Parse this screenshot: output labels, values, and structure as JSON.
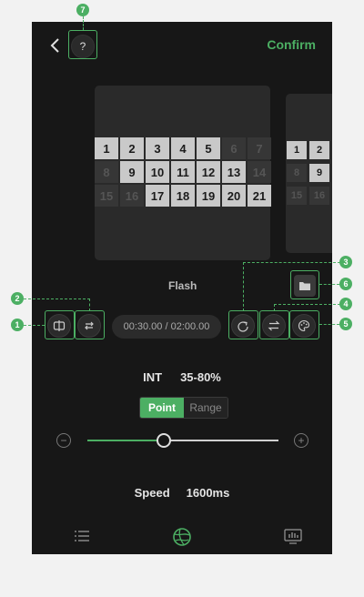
{
  "header": {
    "back_icon": "chevron-left-icon",
    "help_label": "?",
    "confirm_label": "Confirm"
  },
  "pattern": {
    "caption": "Flash",
    "cells": [
      {
        "n": "1",
        "on": true
      },
      {
        "n": "2",
        "on": true
      },
      {
        "n": "3",
        "on": true
      },
      {
        "n": "4",
        "on": true
      },
      {
        "n": "5",
        "on": true
      },
      {
        "n": "6",
        "on": false
      },
      {
        "n": "7",
        "on": false
      },
      {
        "n": "8",
        "on": false
      },
      {
        "n": "9",
        "on": true
      },
      {
        "n": "10",
        "on": true
      },
      {
        "n": "11",
        "on": true
      },
      {
        "n": "12",
        "on": true
      },
      {
        "n": "13",
        "on": true
      },
      {
        "n": "14",
        "on": false
      },
      {
        "n": "15",
        "on": false
      },
      {
        "n": "16",
        "on": false
      },
      {
        "n": "17",
        "on": true
      },
      {
        "n": "18",
        "on": true
      },
      {
        "n": "19",
        "on": true
      },
      {
        "n": "20",
        "on": true
      },
      {
        "n": "21",
        "on": true
      }
    ],
    "next_cells": [
      {
        "n": "1",
        "on": true
      },
      {
        "n": "2",
        "on": true
      },
      {
        "n": "8",
        "on": false
      },
      {
        "n": "9",
        "on": true
      },
      {
        "n": "15",
        "on": false
      },
      {
        "n": "16",
        "on": false
      }
    ]
  },
  "controls": {
    "time": "00:30.00 / 02:00.00",
    "callouts": [
      "1",
      "2",
      "3",
      "4",
      "5",
      "6",
      "7"
    ]
  },
  "intensity": {
    "label": "INT",
    "value": "35-80%",
    "modes": [
      "Point",
      "Range"
    ],
    "active_mode": "Point",
    "slider_level": 0.4
  },
  "speed": {
    "label": "Speed",
    "value": "1600ms"
  },
  "bottom_nav": {
    "icons": [
      "list-icon",
      "effect-globe-icon",
      "music-equalizer-icon"
    ]
  },
  "colors": {
    "accent": "#4caf63",
    "background": "#171717"
  }
}
